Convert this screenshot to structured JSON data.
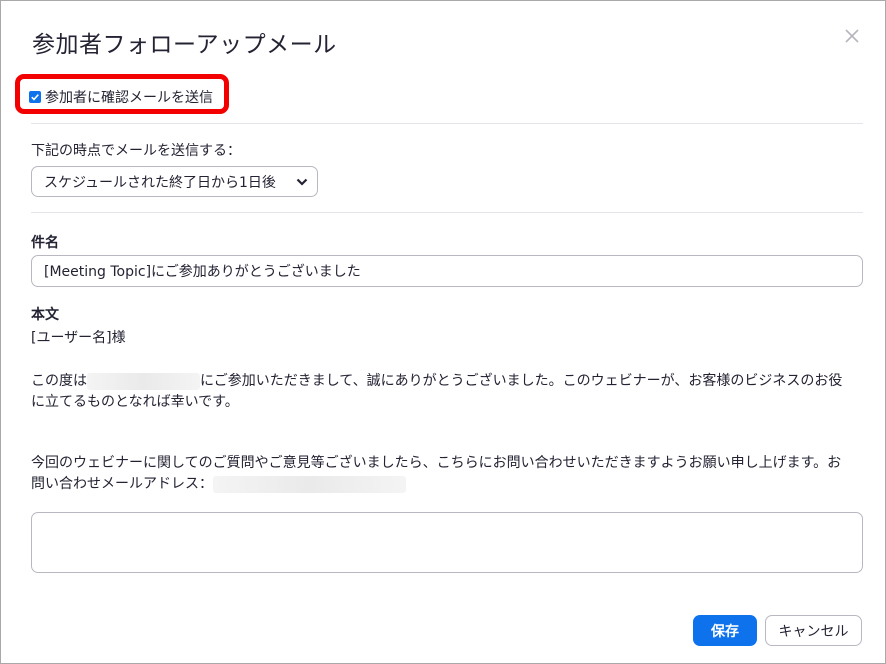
{
  "dialog": {
    "title": "参加者フォローアップメール",
    "close_icon": "close-icon"
  },
  "confirmation": {
    "checkbox_label": "参加者に確認メールを送信",
    "checked": true,
    "highlight_color": "#f30000"
  },
  "timing": {
    "label": "下記の時点でメールを送信する：",
    "selected": "スケジュールされた終了日から1日後"
  },
  "subject": {
    "label": "件名",
    "value": "[Meeting Topic]にご参加ありがとうございました"
  },
  "body": {
    "label": "本文",
    "greeting": "[ユーザー名]様",
    "para1_start": "この度は",
    "para1_after_redacted": "にご参加いただきまして、誠にありがとうございました。このウェビナーが、お客様のビジネスのお役",
    "para1_line2": "に立てるものとなれば幸いです。",
    "para2_line1": "今回のウェビナーに関してのご質問やご意見等ございましたら、こちらにお問い合わせいただきますようお願い申し上げます。お",
    "para2_line2": "問い合わせメールアドレス："
  },
  "buttons": {
    "save": "保存",
    "cancel": "キャンセル"
  },
  "colors": {
    "primary": "#0e72ed",
    "text": "#232333",
    "border": "#b8b8c2"
  }
}
